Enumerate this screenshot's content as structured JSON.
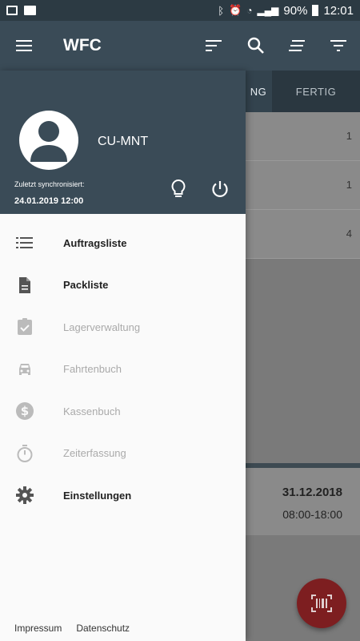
{
  "statusbar": {
    "battery": "90%",
    "time": "12:01"
  },
  "appbar": {
    "title": "WFC"
  },
  "tabs": {
    "active_partial": "NG",
    "other": "FERTIG"
  },
  "list": {
    "rows": [
      {
        "count": "1"
      },
      {
        "count": "1"
      },
      {
        "count": "4"
      }
    ]
  },
  "card": {
    "date": "31.12.2018",
    "time": "08:00-18:00"
  },
  "drawer": {
    "username": "CU-MNT",
    "sync_label": "Zuletzt synchronisiert:",
    "sync_date": "24.01.2019 12:00",
    "items": [
      {
        "label": "Auftragsliste",
        "icon": "list-icon",
        "enabled": true
      },
      {
        "label": "Packliste",
        "icon": "document-icon",
        "enabled": true
      },
      {
        "label": "Lagerverwaltung",
        "icon": "clipboard-check-icon",
        "enabled": false
      },
      {
        "label": "Fahrtenbuch",
        "icon": "car-icon",
        "enabled": false
      },
      {
        "label": "Kassenbuch",
        "icon": "dollar-icon",
        "enabled": false
      },
      {
        "label": "Zeiterfassung",
        "icon": "timer-icon",
        "enabled": false
      },
      {
        "label": "Einstellungen",
        "icon": "gear-icon",
        "enabled": true
      }
    ],
    "footer": {
      "impressum": "Impressum",
      "datenschutz": "Datenschutz"
    }
  },
  "colors": {
    "appbar": "#3a4b57",
    "fab": "#7d1e20",
    "drawer_bg": "#fafafa"
  }
}
